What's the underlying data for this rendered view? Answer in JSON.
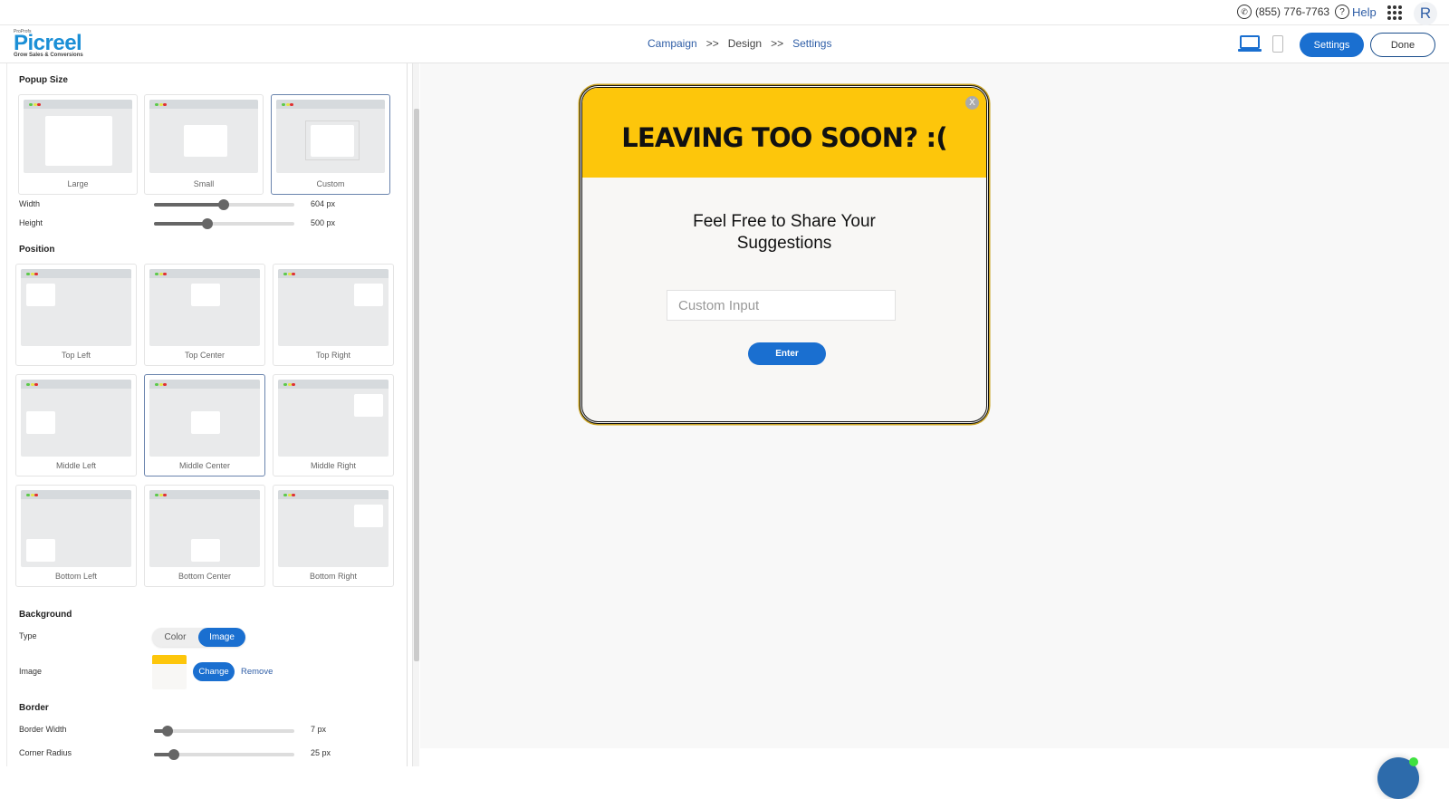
{
  "utility_bar": {
    "phone": "(855) 776-7763",
    "help_label": "Help",
    "avatar_initial": "R"
  },
  "header": {
    "logo": {
      "super": "ProProfs",
      "name": "Picreel",
      "tagline": "Grow Sales & Conversions"
    },
    "breadcrumb": [
      {
        "label": "Campaign",
        "state": "link"
      },
      {
        "label": ">>"
      },
      {
        "label": "Design",
        "state": "current"
      },
      {
        "label": ">>"
      },
      {
        "label": "Settings",
        "state": "link"
      }
    ],
    "device_selected": "desktop",
    "settings_label": "Settings",
    "done_label": "Done"
  },
  "sidebar": {
    "popup_size": {
      "title": "Popup Size",
      "options": [
        {
          "label": "Large",
          "selected": false
        },
        {
          "label": "Small",
          "selected": false
        },
        {
          "label": "Custom",
          "selected": true
        }
      ],
      "width": {
        "label": "Width",
        "value": "604 px",
        "fraction": 0.5
      },
      "height": {
        "label": "Height",
        "value": "500 px",
        "fraction": 0.38
      }
    },
    "position": {
      "title": "Position",
      "options": [
        {
          "label": "Top Left",
          "selected": false
        },
        {
          "label": "Top Center",
          "selected": false
        },
        {
          "label": "Top Right",
          "selected": false
        },
        {
          "label": "Middle Left",
          "selected": false
        },
        {
          "label": "Middle Center",
          "selected": true
        },
        {
          "label": "Middle Right",
          "selected": false
        },
        {
          "label": "Bottom Left",
          "selected": false
        },
        {
          "label": "Bottom Center",
          "selected": false
        },
        {
          "label": "Bottom Right",
          "selected": false
        }
      ]
    },
    "background": {
      "title": "Background",
      "type_label": "Type",
      "type_options": [
        "Color",
        "Image"
      ],
      "type_selected": "Image",
      "image_label": "Image",
      "change_label": "Change",
      "remove_label": "Remove"
    },
    "border": {
      "title": "Border",
      "width": {
        "label": "Border Width",
        "value": "7 px",
        "fraction": 0.1
      },
      "radius": {
        "label": "Corner Radius",
        "value": "25 px",
        "fraction": 0.14
      }
    }
  },
  "preview": {
    "title": "LEAVING TOO SOON? :(",
    "close_label": "X",
    "subtitle_line1": "Feel Free to Share Your",
    "subtitle_line2": "Suggestions",
    "input_placeholder": "Custom Input",
    "button_label": "Enter",
    "colors": {
      "header": "#fdc60b",
      "body": "#f8f7f5",
      "button": "#1a6fd0",
      "border": "#111111"
    }
  },
  "colors": {
    "accent": "#1a6fd0",
    "link": "#2f5ea6",
    "brand": "#1b8fd6"
  }
}
